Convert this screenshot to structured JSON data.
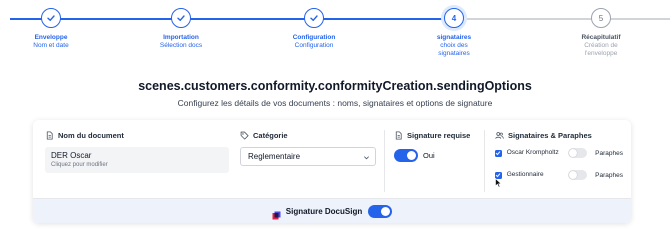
{
  "stepper": {
    "steps": [
      {
        "title": "Enveloppe",
        "sub": "Nom et date",
        "state": "done"
      },
      {
        "title": "Importation",
        "sub": "Sélection docs",
        "state": "done"
      },
      {
        "title": "Configuration",
        "sub": "Configuration",
        "state": "done"
      },
      {
        "number": "4",
        "title": "signataires",
        "sub": "choix des signataires",
        "state": "current"
      },
      {
        "number": "5",
        "title": "Récapitulatif",
        "sub": "Création de l'enveloppe",
        "state": "todo"
      }
    ]
  },
  "header": {
    "title": "scenes.customers.conformity.conformityCreation.sendingOptions",
    "subtitle": "Configurez les détails de vos documents : noms, signataires et options de signature"
  },
  "document": {
    "label": "Nom du document",
    "value": "DER Oscar",
    "hint": "Cliquez pour modifier"
  },
  "category": {
    "label": "Catégorie",
    "selected": "Reglementaire"
  },
  "signature_required": {
    "label": "Signature requise",
    "toggle_label": "Oui",
    "on": true
  },
  "signers": {
    "label": "Signataires & Paraphes",
    "items": [
      {
        "name": "Oscar Krompholtz",
        "checked": true,
        "paraphes_label": "Paraphes",
        "paraphes_on": false
      },
      {
        "name": "Gestionnaire",
        "checked": true,
        "paraphes_label": "Paraphes",
        "paraphes_on": false
      }
    ]
  },
  "docusign": {
    "label": "Signature DocuSign",
    "on": true
  },
  "colors": {
    "accent": "#2563eb",
    "muted": "#9ca3af",
    "footer_bg": "#eef2fb"
  }
}
